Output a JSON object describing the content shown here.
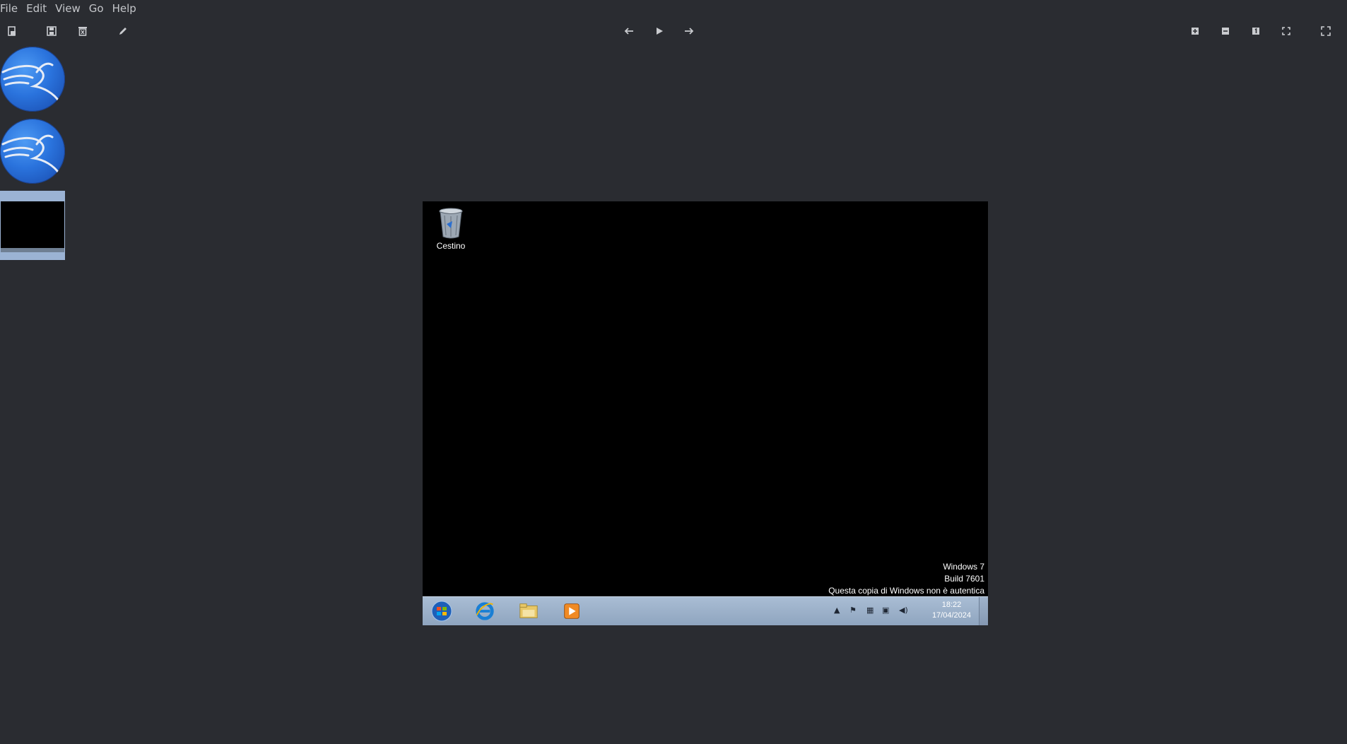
{
  "menu": [
    "File",
    "Edit",
    "View",
    "Go",
    "Help"
  ],
  "toolbar": {
    "left": [
      "open-icon",
      "save-icon",
      "delete-icon",
      "edit-icon"
    ],
    "center": [
      "previous-icon",
      "play-slideshow-icon",
      "next-icon"
    ],
    "right": [
      "zoom-in-icon",
      "zoom-out-icon",
      "zoom-100-icon",
      "zoom-fit-icon",
      "fullscreen-icon"
    ]
  },
  "thumbnails": [
    {
      "name": "kali-logo"
    },
    {
      "name": "kali-logo"
    },
    {
      "name": "windows-desktop-screenshot",
      "selected": true
    }
  ],
  "image": {
    "desktop": {
      "recycle_bin_label": "Cestino",
      "watermark_line1": "Windows 7",
      "watermark_line2": "Build 7601",
      "watermark_line3": "Questa copia di Windows non è autentica"
    },
    "taskbar": {
      "apps": [
        "windows-start-icon",
        "internet-explorer-icon",
        "file-explorer-icon",
        "media-player-icon"
      ],
      "tray": [
        "tray-expand-icon",
        "action-center-icon",
        "network-icon",
        "display-icon",
        "volume-icon"
      ],
      "time": "18:22",
      "date": "17/04/2024"
    }
  },
  "colors": {
    "app_background": "#2a2c31",
    "selected_thumbnail": "#9bb3d4",
    "kali_blue": "#2a73dd",
    "taskbar": "#a9bdd4"
  }
}
